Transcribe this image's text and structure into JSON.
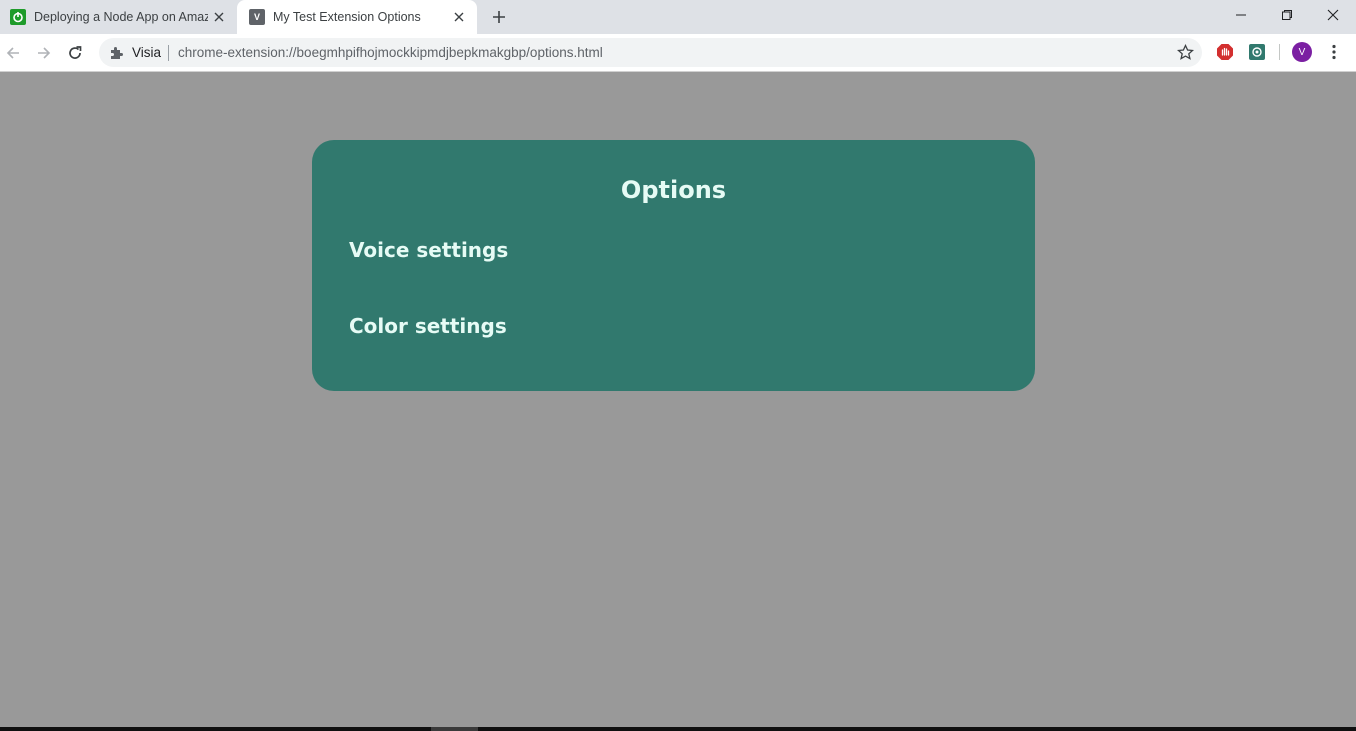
{
  "tabs": [
    {
      "title": "Deploying a Node App on Amazon",
      "favicon": "green-power-icon"
    },
    {
      "title": "My Test Extension Options",
      "favicon_letter": "V"
    }
  ],
  "omnibox": {
    "site_label": "Visia",
    "url": "chrome-extension://boegmhpifhojmockkipmdjbepkmakgbp/options.html"
  },
  "profile": {
    "initial": "V"
  },
  "page": {
    "heading": "Options",
    "sections": [
      "Voice settings",
      "Color settings"
    ]
  },
  "colors": {
    "page_background": "#999999",
    "card_background": "#31796e",
    "card_text": "#e6fbf5",
    "profile_avatar": "#7b1fa2"
  }
}
